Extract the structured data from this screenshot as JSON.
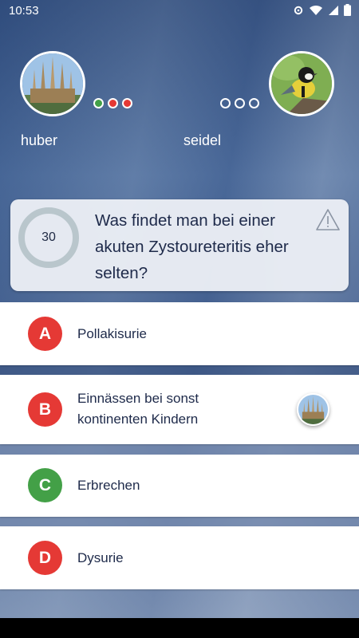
{
  "status_bar": {
    "time": "10:53",
    "icons": [
      "settings-icon",
      "wifi-icon",
      "signal-icon",
      "battery-icon"
    ]
  },
  "players": {
    "left": {
      "name": "huber",
      "avatar": "cathedral-photo",
      "results": [
        "correct",
        "wrong",
        "wrong"
      ]
    },
    "right": {
      "name": "seidel",
      "avatar": "bird-photo",
      "results": [
        "pending",
        "pending",
        "pending"
      ]
    }
  },
  "question": {
    "timer": "30",
    "text": "Was findet man bei einer akuten Zystoureteritis eher selten?",
    "report_icon": "warning-triangle-icon"
  },
  "answers": [
    {
      "letter": "A",
      "text": "Pollakisurie",
      "color": "#e53935"
    },
    {
      "letter": "B",
      "text": "Einnässen bei sonst kontinenten Kindern",
      "color": "#e53935",
      "chosen_by": "huber"
    },
    {
      "letter": "C",
      "text": "Erbrechen",
      "color": "#43a047"
    },
    {
      "letter": "D",
      "text": "Dysurie",
      "color": "#e53935"
    }
  ],
  "colors": {
    "correct": "#43a047",
    "wrong": "#e53935",
    "text": "#1e2a4a"
  }
}
